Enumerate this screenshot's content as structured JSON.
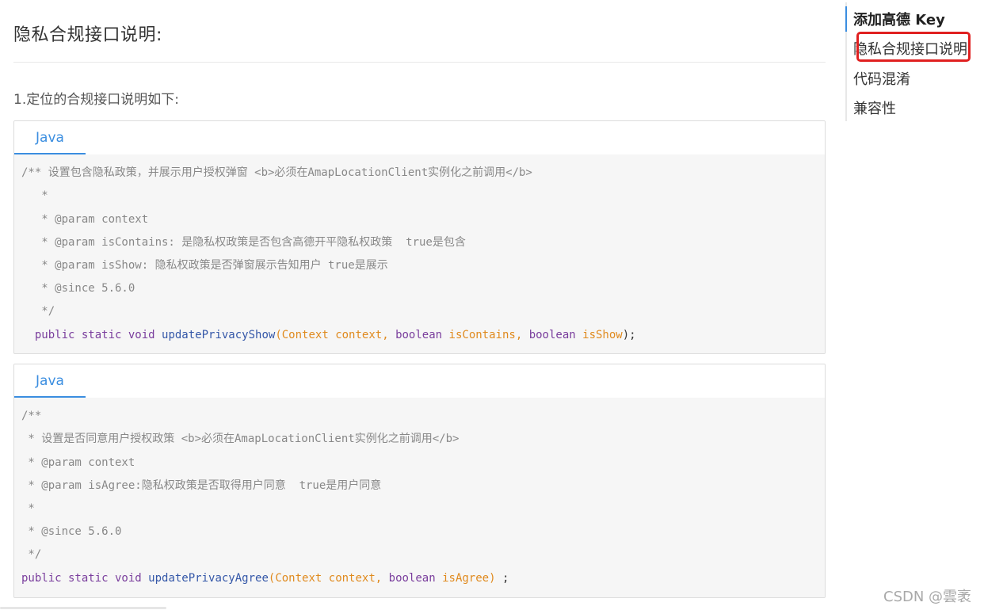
{
  "page": {
    "title": "隐私合规接口说明:",
    "section_intro": "1.定位的合规接口说明如下:"
  },
  "code_blocks": [
    {
      "tab": "Java",
      "lines": [
        "/** 设置包含隐私政策，并展示用户授权弹窗 <b>必须在AmapLocationClient实例化之前调用</b>",
        "   *",
        "   * @param context",
        "   * @param isContains: 是隐私权政策是否包含高德开平隐私权政策  true是包含",
        "   * @param isShow: 隐私权政策是否弹窗展示告知用户 true是展示",
        "   * @since 5.6.0",
        "   */"
      ],
      "signature": {
        "indent": "  ",
        "keywords": "public static void",
        "method": "updatePrivacyShow",
        "open": "(",
        "p1_type": "Context",
        "p1_name": "context,",
        "p2_type": "boolean",
        "p2_name": "isContains,",
        "p3_type": "boolean",
        "p3_name": "isShow",
        "close": ");"
      }
    },
    {
      "tab": "Java",
      "lines": [
        "/**",
        " * 设置是否同意用户授权政策 <b>必须在AmapLocationClient实例化之前调用</b>",
        " * @param context",
        " * @param isAgree:隐私权政策是否取得用户同意  true是用户同意",
        " *",
        " * @since 5.6.0",
        " */"
      ],
      "signature": {
        "keywords": "public static void",
        "method": "updatePrivacyAgree",
        "open": "(",
        "p1_type": "Context",
        "p1_name": "context,",
        "p2_type": "boolean",
        "p2_name": "isAgree)",
        "close": ";"
      }
    }
  ],
  "toc": {
    "items": [
      "添加高德 Key",
      "隐私合规接口说明:",
      "代码混淆",
      "兼容性"
    ],
    "active_index": 0,
    "highlighted_index": 1
  },
  "watermark": "CSDN @雲袤",
  "colors": {
    "accent": "#3b8ee0",
    "highlight_box": "#e02020",
    "keyword": "#7a3e9d",
    "function": "#3457a8",
    "param": "#e08a1e",
    "comment": "#888888"
  }
}
